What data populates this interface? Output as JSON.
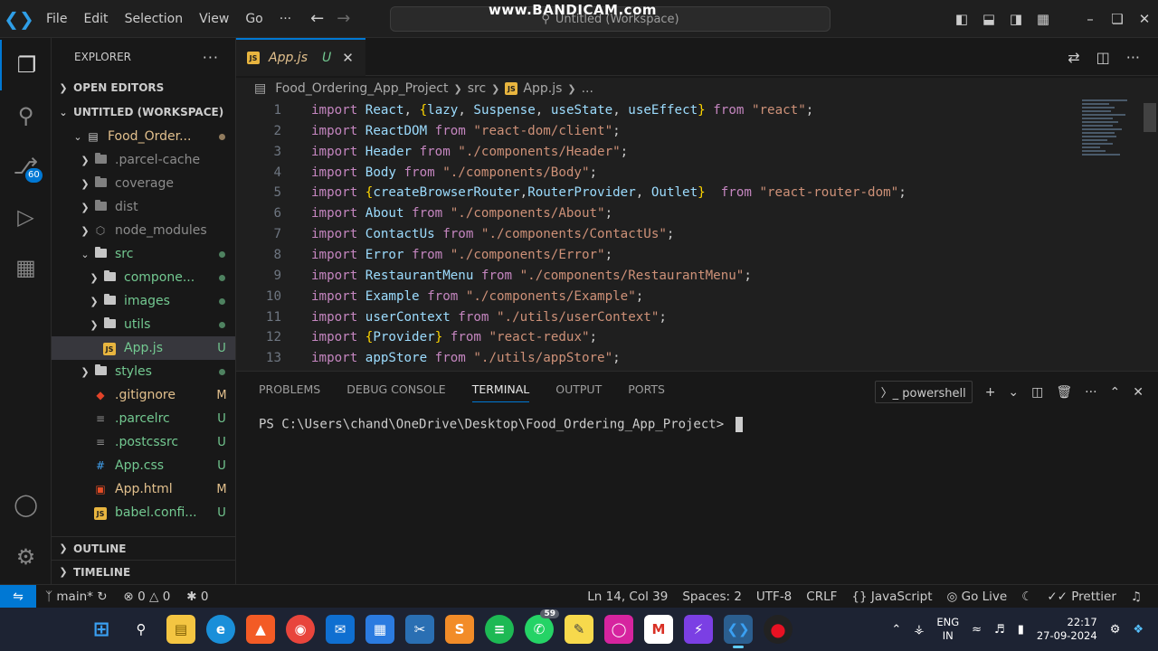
{
  "watermark": "www.BANDICAM.com",
  "menu": [
    "File",
    "Edit",
    "Selection",
    "View",
    "Go",
    "···"
  ],
  "command_center": "Untitled (Workspace)",
  "activity": {
    "source_control_badge": "60"
  },
  "explorer": {
    "title": "EXPLORER",
    "sections": {
      "open_editors": "OPEN EDITORS",
      "workspace": "UNTITLED (WORKSPACE)",
      "outline": "OUTLINE",
      "timeline": "TIMELINE"
    },
    "tree": [
      {
        "label": "Food_Order...",
        "status": "dot",
        "kind": "root"
      },
      {
        "label": ".parcel-cache",
        "status": "",
        "kind": "folder"
      },
      {
        "label": "coverage",
        "status": "",
        "kind": "folder"
      },
      {
        "label": "dist",
        "status": "",
        "kind": "folder"
      },
      {
        "label": "node_modules",
        "status": "",
        "kind": "folder"
      },
      {
        "label": "src",
        "status": "dot",
        "kind": "folder"
      },
      {
        "label": "compone...",
        "status": "dot",
        "kind": "folder"
      },
      {
        "label": "images",
        "status": "dot",
        "kind": "folder"
      },
      {
        "label": "utils",
        "status": "dot",
        "kind": "folder"
      },
      {
        "label": "App.js",
        "status": "U",
        "kind": "js"
      },
      {
        "label": "styles",
        "status": "dot",
        "kind": "folder"
      },
      {
        "label": ".gitignore",
        "status": "M",
        "kind": "git"
      },
      {
        "label": ".parcelrc",
        "status": "U",
        "kind": "file"
      },
      {
        "label": ".postcssrc",
        "status": "U",
        "kind": "file"
      },
      {
        "label": "App.css",
        "status": "U",
        "kind": "css"
      },
      {
        "label": "App.html",
        "status": "M",
        "kind": "html"
      },
      {
        "label": "babel.confi...",
        "status": "U",
        "kind": "js"
      }
    ]
  },
  "tab": {
    "name": "App.js",
    "status": "U",
    "icon_text": "JS"
  },
  "breadcrumb": [
    "Food_Ordering_App_Project",
    "src",
    "App.js",
    "..."
  ],
  "code_lines": [
    {
      "n": "1",
      "parts": [
        [
          "kw",
          "import "
        ],
        [
          "var",
          "React"
        ],
        [
          "plain",
          ", "
        ],
        [
          "br",
          "{"
        ],
        [
          "var",
          "lazy"
        ],
        [
          "plain",
          ", "
        ],
        [
          "var",
          "Suspense"
        ],
        [
          "plain",
          ", "
        ],
        [
          "var",
          "useState"
        ],
        [
          "plain",
          ", "
        ],
        [
          "var",
          "useEffect"
        ],
        [
          "br",
          "}"
        ],
        [
          "kw",
          " from "
        ],
        [
          "str",
          "\"react\""
        ],
        [
          "plain",
          ";"
        ]
      ]
    },
    {
      "n": "2",
      "parts": [
        [
          "kw",
          "import "
        ],
        [
          "var",
          "ReactDOM"
        ],
        [
          "kw",
          " from "
        ],
        [
          "str",
          "\"react-dom/client\""
        ],
        [
          "plain",
          ";"
        ]
      ]
    },
    {
      "n": "3",
      "parts": [
        [
          "kw",
          "import "
        ],
        [
          "var",
          "Header"
        ],
        [
          "kw",
          " from "
        ],
        [
          "str",
          "\"./components/Header\""
        ],
        [
          "plain",
          ";"
        ]
      ]
    },
    {
      "n": "4",
      "parts": [
        [
          "kw",
          "import "
        ],
        [
          "var",
          "Body"
        ],
        [
          "kw",
          " from "
        ],
        [
          "str",
          "\"./components/Body\""
        ],
        [
          "plain",
          ";"
        ]
      ]
    },
    {
      "n": "5",
      "parts": [
        [
          "kw",
          "import "
        ],
        [
          "br",
          "{"
        ],
        [
          "var",
          "createBrowserRouter"
        ],
        [
          "plain",
          ","
        ],
        [
          "var",
          "RouterProvider"
        ],
        [
          "plain",
          ", "
        ],
        [
          "var",
          "Outlet"
        ],
        [
          "br",
          "}"
        ],
        [
          "kw",
          "  from "
        ],
        [
          "str",
          "\"react-router-dom\""
        ],
        [
          "plain",
          ";"
        ]
      ]
    },
    {
      "n": "6",
      "parts": [
        [
          "kw",
          "import "
        ],
        [
          "var",
          "About"
        ],
        [
          "kw",
          " from "
        ],
        [
          "str",
          "\"./components/About\""
        ],
        [
          "plain",
          ";"
        ]
      ]
    },
    {
      "n": "7",
      "parts": [
        [
          "kw",
          "import "
        ],
        [
          "var",
          "ContactUs"
        ],
        [
          "kw",
          " from "
        ],
        [
          "str",
          "\"./components/ContactUs\""
        ],
        [
          "plain",
          ";"
        ]
      ]
    },
    {
      "n": "8",
      "parts": [
        [
          "kw",
          "import "
        ],
        [
          "var",
          "Error"
        ],
        [
          "kw",
          " from "
        ],
        [
          "str",
          "\"./components/Error\""
        ],
        [
          "plain",
          ";"
        ]
      ]
    },
    {
      "n": "9",
      "parts": [
        [
          "kw",
          "import "
        ],
        [
          "var",
          "RestaurantMenu"
        ],
        [
          "kw",
          " from "
        ],
        [
          "str",
          "\"./components/RestaurantMenu\""
        ],
        [
          "plain",
          ";"
        ]
      ]
    },
    {
      "n": "10",
      "parts": [
        [
          "kw",
          "import "
        ],
        [
          "var",
          "Example"
        ],
        [
          "kw",
          " from "
        ],
        [
          "str",
          "\"./components/Example\""
        ],
        [
          "plain",
          ";"
        ]
      ]
    },
    {
      "n": "11",
      "parts": [
        [
          "kw",
          "import "
        ],
        [
          "var",
          "userContext"
        ],
        [
          "kw",
          " from "
        ],
        [
          "str",
          "\"./utils/userContext\""
        ],
        [
          "plain",
          ";"
        ]
      ]
    },
    {
      "n": "12",
      "parts": [
        [
          "kw",
          "import "
        ],
        [
          "br",
          "{"
        ],
        [
          "var",
          "Provider"
        ],
        [
          "br",
          "}"
        ],
        [
          "kw",
          " from "
        ],
        [
          "str",
          "\"react-redux\""
        ],
        [
          "plain",
          ";"
        ]
      ]
    },
    {
      "n": "13",
      "parts": [
        [
          "kw",
          "import "
        ],
        [
          "var",
          "appStore"
        ],
        [
          "kw",
          " from "
        ],
        [
          "str",
          "\"./utils/appStore\""
        ],
        [
          "plain",
          ";"
        ]
      ]
    }
  ],
  "panel": {
    "tabs": [
      "PROBLEMS",
      "DEBUG CONSOLE",
      "TERMINAL",
      "OUTPUT",
      "PORTS"
    ],
    "active_tab": "TERMINAL",
    "shell": "powershell",
    "prompt": "PS C:\\Users\\chand\\OneDrive\\Desktop\\Food_Ordering_App_Project> "
  },
  "status": {
    "branch": "main*",
    "errors": "0",
    "warnings": "0",
    "ports": "0",
    "position": "Ln 14, Col 39",
    "spaces": "Spaces: 2",
    "encoding": "UTF-8",
    "eol": "CRLF",
    "language": "JavaScript",
    "go_live": "Go Live",
    "prettier": "Prettier"
  },
  "taskbar": {
    "whatsapp_badge": "59",
    "lang_top": "ENG",
    "lang_bottom": "IN",
    "time": "22:17",
    "date": "27-09-2024"
  },
  "colors": {
    "accent": "#0078d4",
    "keyword": "#c586c0",
    "variable": "#9cdcfe",
    "string": "#ce9178",
    "untracked": "#73c991",
    "modified": "#e2c08d"
  }
}
